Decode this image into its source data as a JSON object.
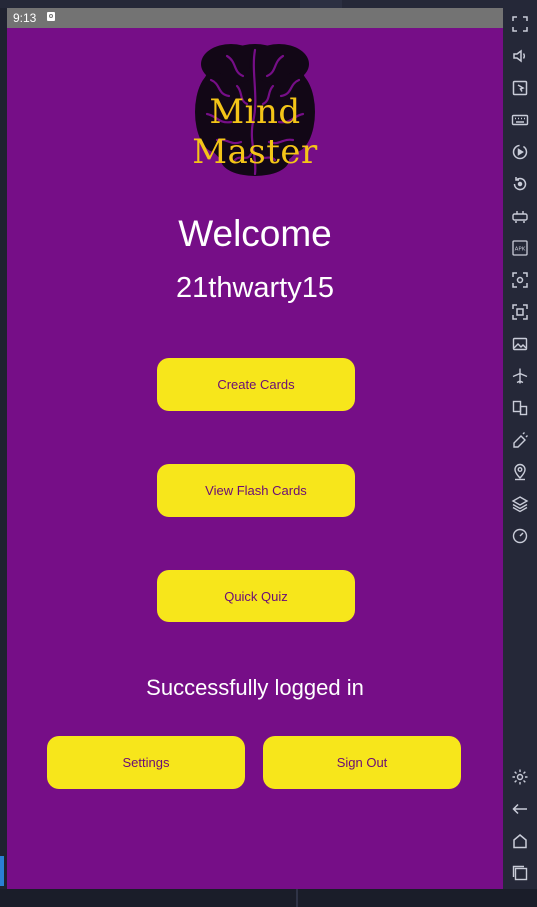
{
  "status_bar": {
    "time": "9:13"
  },
  "app": {
    "logo_text": "Mind Master",
    "welcome": "Welcome",
    "username": "21thwarty15",
    "buttons": {
      "create_cards": "Create Cards",
      "view_flash_cards": "View Flash Cards",
      "quick_quiz": "Quick Quiz",
      "settings": "Settings",
      "sign_out": "Sign Out"
    },
    "status_message": "Successfully logged in"
  },
  "colors": {
    "background": "#760e87",
    "button": "#f7e61b",
    "button_text": "#6a0c78",
    "logo_text": "#f4c518"
  },
  "emulator_toolbar": {
    "icons": [
      "fullscreen-icon",
      "volume-icon",
      "pointer-icon",
      "keyboard-icon",
      "record-icon",
      "rotate-icon",
      "controller-icon",
      "apk-icon",
      "screenshot-icon",
      "screen-record-icon",
      "media-icon",
      "airplane-icon",
      "multi-instance-icon",
      "erase-icon",
      "location-icon",
      "layers-icon",
      "speed-icon",
      "settings-icon",
      "back-icon",
      "home-icon",
      "recents-icon"
    ]
  }
}
